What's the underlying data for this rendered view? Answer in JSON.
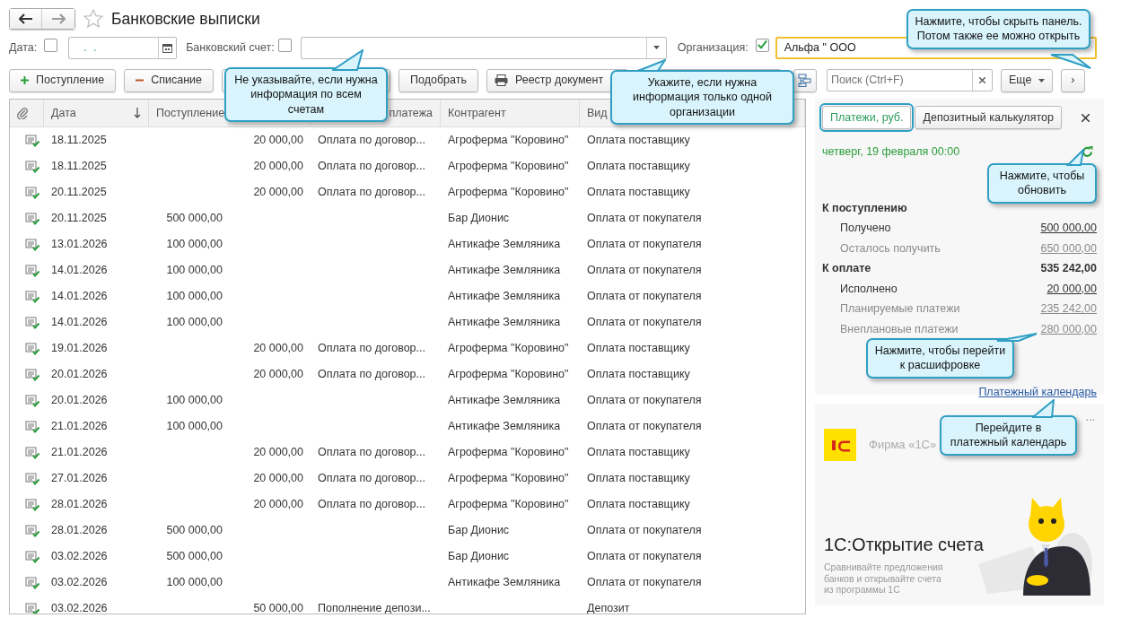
{
  "window": {
    "title": "Банковские выписки"
  },
  "filters": {
    "date": {
      "label": "Дата:",
      "checked": false,
      "value": ". ."
    },
    "account": {
      "label": "Банковский счет:",
      "checked": false
    },
    "organization": {
      "label": "Организация:",
      "checked": true,
      "value": "Альфа \" ООО"
    }
  },
  "toolbar": [
    {
      "kind": "add",
      "label": "Поступление"
    },
    {
      "kind": "remove",
      "label": "Списание"
    },
    {
      "kind": "blank"
    },
    {
      "kind": "plain",
      "label": "Подобрать"
    },
    {
      "kind": "print",
      "label": "Реестр документ"
    },
    {
      "kind": "blank"
    },
    {
      "kind": "structure"
    }
  ],
  "search": {
    "placeholder": "Поиск (Ctrl+F)"
  },
  "more_button": "Еще",
  "panel_toggle": "›",
  "table": {
    "columns": [
      {
        "label": "Дата",
        "sorted": true
      },
      {
        "label": "Поступление"
      },
      {},
      {
        "label": "платежа",
        "sorted": false
      },
      {
        "label": "Контрагент",
        "sorted": false
      },
      {
        "label": "Вид",
        "sorted": false
      }
    ],
    "rows": [
      {
        "posted": true,
        "date": "18.11.2025",
        "expense": "20 000,00",
        "purpose": "Оплата по договор...",
        "counterparty": "Агроферма \"Коровино\"",
        "type": "Оплата поставщику"
      },
      {
        "posted": true,
        "date": "18.11.2025",
        "expense": "20 000,00",
        "purpose": "Оплата по договор...",
        "counterparty": "Агроферма \"Коровино\"",
        "type": "Оплата поставщику"
      },
      {
        "posted": true,
        "date": "20.11.2025",
        "expense": "20 000,00",
        "purpose": "Оплата по договор...",
        "counterparty": "Агроферма \"Коровино\"",
        "type": "Оплата поставщику"
      },
      {
        "posted": true,
        "date": "20.11.2025",
        "income": "500 000,00",
        "counterparty": "Бар Дионис",
        "type": "Оплата от покупателя"
      },
      {
        "posted": true,
        "date": "13.01.2026",
        "income": "100 000,00",
        "counterparty": "Антикафе Земляника",
        "type": "Оплата от покупателя"
      },
      {
        "posted": true,
        "date": "14.01.2026",
        "income": "100 000,00",
        "counterparty": "Антикафе Земляника",
        "type": "Оплата от покупателя"
      },
      {
        "posted": true,
        "date": "14.01.2026",
        "income": "100 000,00",
        "counterparty": "Антикафе Земляника",
        "type": "Оплата от покупателя"
      },
      {
        "posted": true,
        "date": "14.01.2026",
        "income": "100 000,00",
        "counterparty": "Антикафе Земляника",
        "type": "Оплата от покупателя"
      },
      {
        "posted": true,
        "date": "19.01.2026",
        "expense": "20 000,00",
        "purpose": "Оплата по договор...",
        "counterparty": "Агроферма \"Коровино\"",
        "type": "Оплата поставщику"
      },
      {
        "posted": true,
        "date": "20.01.2026",
        "expense": "20 000,00",
        "purpose": "Оплата по договор...",
        "counterparty": "Агроферма \"Коровино\"",
        "type": "Оплата поставщику"
      },
      {
        "posted": true,
        "date": "20.01.2026",
        "income": "100 000,00",
        "counterparty": "Антикафе Земляника",
        "type": "Оплата от покупателя"
      },
      {
        "posted": true,
        "date": "21.01.2026",
        "income": "100 000,00",
        "counterparty": "Антикафе Земляника",
        "type": "Оплата от покупателя"
      },
      {
        "posted": true,
        "date": "21.01.2026",
        "expense": "20 000,00",
        "purpose": "Оплата по договор...",
        "counterparty": "Агроферма \"Коровино\"",
        "type": "Оплата поставщику"
      },
      {
        "posted": true,
        "date": "27.01.2026",
        "expense": "20 000,00",
        "purpose": "Оплата по договор...",
        "counterparty": "Агроферма \"Коровино\"",
        "type": "Оплата поставщику"
      },
      {
        "posted": true,
        "date": "28.01.2026",
        "expense": "20 000,00",
        "purpose": "Оплата по договор...",
        "counterparty": "Агроферма \"Коровино\"",
        "type": "Оплата поставщику"
      },
      {
        "posted": true,
        "date": "28.01.2026",
        "income": "500 000,00",
        "counterparty": "Бар Дионис",
        "type": "Оплата от покупателя"
      },
      {
        "posted": true,
        "date": "03.02.2026",
        "income": "500 000,00",
        "counterparty": "Бар Дионис",
        "type": "Оплата от покупателя"
      },
      {
        "posted": true,
        "date": "03.02.2026",
        "income": "100 000,00",
        "counterparty": "Антикафе Земляника",
        "type": "Оплата от покупателя"
      },
      {
        "posted": true,
        "date": "03.02.2026",
        "expense": "50 000,00",
        "purpose": "Пополнение депози...",
        "type": "Депозит"
      }
    ]
  },
  "panel": {
    "tabs": [
      {
        "label": "Платежи, руб.",
        "selected": true
      },
      {
        "label": "Депозитный калькулятор",
        "selected": false
      }
    ],
    "date": "четверг, 19 февраля 00:00",
    "summary": [
      {
        "kind": "total",
        "label": "К поступлению"
      },
      {
        "kind": "item",
        "label": "Получено",
        "value": "500 000,00",
        "muted": false
      },
      {
        "kind": "item",
        "label": "Осталось получить",
        "value": "650 000,00",
        "muted": true
      },
      {
        "kind": "total",
        "label": "К оплате",
        "value": "535 242,00"
      },
      {
        "kind": "item",
        "label": "Исполнено",
        "value": "20 000,00",
        "muted": false
      },
      {
        "kind": "item",
        "label": "Планируемые платежи",
        "value": "235 242,00",
        "muted": true
      },
      {
        "kind": "item",
        "label": "Внеплановые платежи",
        "value": "280 000,00",
        "muted": true
      }
    ],
    "calendar_link": "Платежный календарь"
  },
  "ad": {
    "brand": "Фирма «1С»",
    "menu": "...",
    "title": "1С:Открытие счета",
    "text": "Сравнивайте предложения банков и открывайте счета из программы 1С"
  },
  "callouts": [
    {
      "text": "Не указывайте, если нужна информация по всем счетам"
    },
    {
      "text": "Укажите, если нужна информация только одной организации"
    },
    {
      "text": "Нажмите, чтобы скрыть панель. Потом также ее можно открыть"
    },
    {
      "text": "Нажмите, чтобы обновить"
    },
    {
      "text": "Нажмите, чтобы перейти к расшифровке"
    },
    {
      "text": "Перейдите в платежный календарь"
    }
  ]
}
